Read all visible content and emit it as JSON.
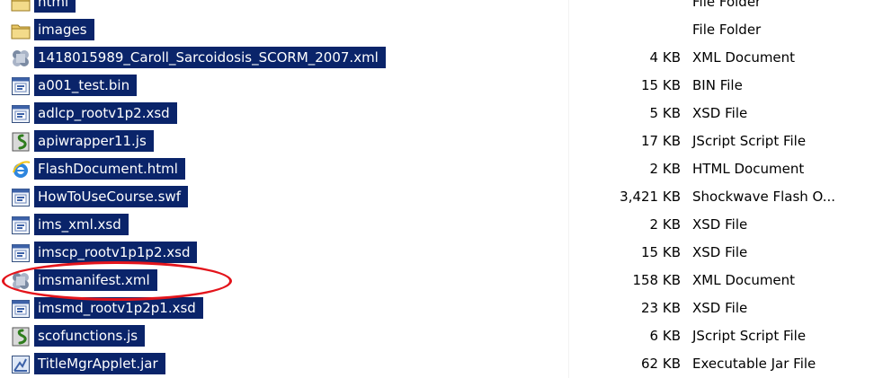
{
  "files": [
    {
      "name": "html",
      "size": "",
      "type": "File Folder",
      "icon": "folder-icon"
    },
    {
      "name": "images",
      "size": "",
      "type": "File Folder",
      "icon": "folder-icon"
    },
    {
      "name": "1418015989_Caroll_Sarcoidosis_SCORM_2007.xml",
      "size": "4 KB",
      "type": "XML Document",
      "icon": "xml-file-icon"
    },
    {
      "name": "a001_test.bin",
      "size": "15 KB",
      "type": "BIN File",
      "icon": "generic-file-icon"
    },
    {
      "name": "adlcp_rootv1p2.xsd",
      "size": "5 KB",
      "type": "XSD File",
      "icon": "generic-file-icon"
    },
    {
      "name": "apiwrapper11.js",
      "size": "17 KB",
      "type": "JScript Script File",
      "icon": "script-file-icon"
    },
    {
      "name": "FlashDocument.html",
      "size": "2 KB",
      "type": "HTML Document",
      "icon": "internet-explorer-icon"
    },
    {
      "name": "HowToUseCourse.swf",
      "size": "3,421 KB",
      "type": "Shockwave Flash O...",
      "icon": "generic-file-icon"
    },
    {
      "name": "ims_xml.xsd",
      "size": "2 KB",
      "type": "XSD File",
      "icon": "generic-file-icon"
    },
    {
      "name": "imscp_rootv1p1p2.xsd",
      "size": "15 KB",
      "type": "XSD File",
      "icon": "generic-file-icon"
    },
    {
      "name": "imsmanifest.xml",
      "size": "158 KB",
      "type": "XML Document",
      "icon": "xml-file-icon",
      "circled": true
    },
    {
      "name": "imsmd_rootv1p2p1.xsd",
      "size": "23 KB",
      "type": "XSD File",
      "icon": "generic-file-icon"
    },
    {
      "name": "scofunctions.js",
      "size": "6 KB",
      "type": "JScript Script File",
      "icon": "script-file-icon"
    },
    {
      "name": "TitleMgrApplet.jar",
      "size": "62 KB",
      "type": "Executable Jar File",
      "icon": "jar-file-icon"
    }
  ],
  "colors": {
    "selection_bg": "#0a246a",
    "selection_text": "#ffffff",
    "annotation": "#e3141b"
  }
}
